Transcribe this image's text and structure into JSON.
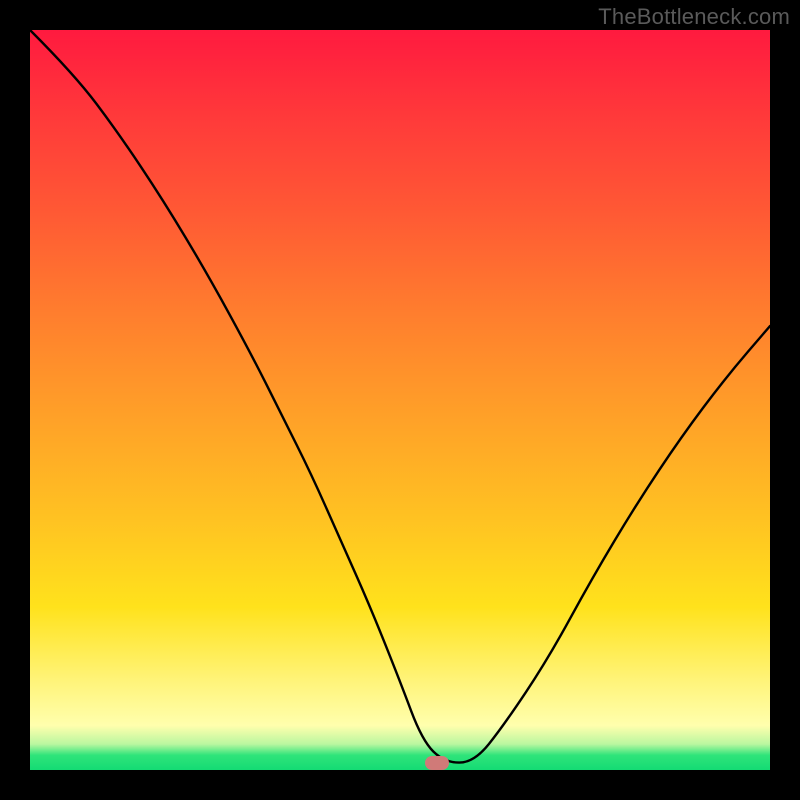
{
  "watermark": "TheBottleneck.com",
  "marker": {
    "x_pct": 55,
    "y_pct": 99
  },
  "chart_data": {
    "type": "line",
    "title": "",
    "xlabel": "",
    "ylabel": "",
    "xlim": [
      0,
      100
    ],
    "ylim": [
      0,
      100
    ],
    "background_gradient": [
      {
        "pct": 0,
        "color": "#ff1a3f"
      },
      {
        "pct": 50,
        "color": "#ffa028"
      },
      {
        "pct": 82,
        "color": "#ffe21c"
      },
      {
        "pct": 94,
        "color": "#ffffad"
      },
      {
        "pct": 100,
        "color": "#14db74"
      }
    ],
    "series": [
      {
        "name": "bottleneck-curve",
        "x": [
          0,
          6,
          12,
          18,
          24,
          30,
          34,
          38,
          42,
          46,
          50,
          53,
          56,
          60,
          64,
          70,
          76,
          82,
          88,
          94,
          100
        ],
        "y": [
          100,
          94,
          86,
          77,
          67,
          56,
          48,
          40,
          31,
          22,
          12,
          4,
          1,
          1,
          6,
          15,
          26,
          36,
          45,
          53,
          60
        ]
      }
    ],
    "marker": {
      "x": 55,
      "y": 0.5
    },
    "legend": false,
    "grid": false
  }
}
